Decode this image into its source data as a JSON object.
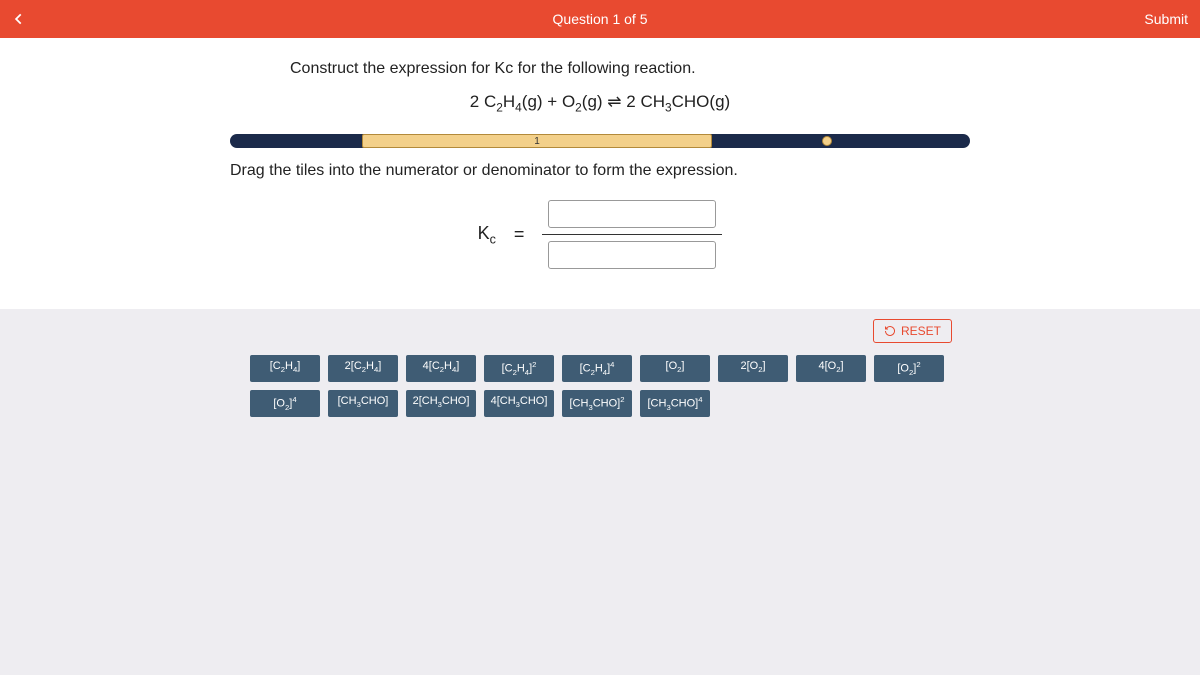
{
  "header": {
    "question_title": "Question 1 of 5",
    "submit_label": "Submit"
  },
  "prompt": {
    "line1": "Construct the expression for Kc for the following reaction.",
    "reaction_html": "2 C<sub>2</sub>H<sub>4</sub>(g) + O<sub>2</sub>(g) ⇌ 2 CH<sub>3</sub>CHO(g)",
    "progress_step_label": "1",
    "line2": "Drag the tiles into the numerator or denominator to form the expression.",
    "kc_label_html": "K<sub>c</sub>",
    "equals": "="
  },
  "reset_label": "RESET",
  "tiles": [
    "[C<sub>2</sub>H<sub>4</sub>]",
    "2[C<sub>2</sub>H<sub>4</sub>]",
    "4[C<sub>2</sub>H<sub>4</sub>]",
    "[C<sub>2</sub>H<sub>4</sub>]<sup>2</sup>",
    "[C<sub>2</sub>H<sub>4</sub>]<sup>4</sup>",
    "[O<sub>2</sub>]",
    "2[O<sub>2</sub>]",
    "4[O<sub>2</sub>]",
    "[O<sub>2</sub>]<sup>2</sup>",
    "[O<sub>2</sub>]<sup>4</sup>",
    "[CH<sub>3</sub>CHO]",
    "2[CH<sub>3</sub>CHO]",
    "4[CH<sub>3</sub>CHO]",
    "[CH<sub>3</sub>CHO]<sup>2</sup>",
    "[CH<sub>3</sub>CHO]<sup>4</sup>"
  ]
}
